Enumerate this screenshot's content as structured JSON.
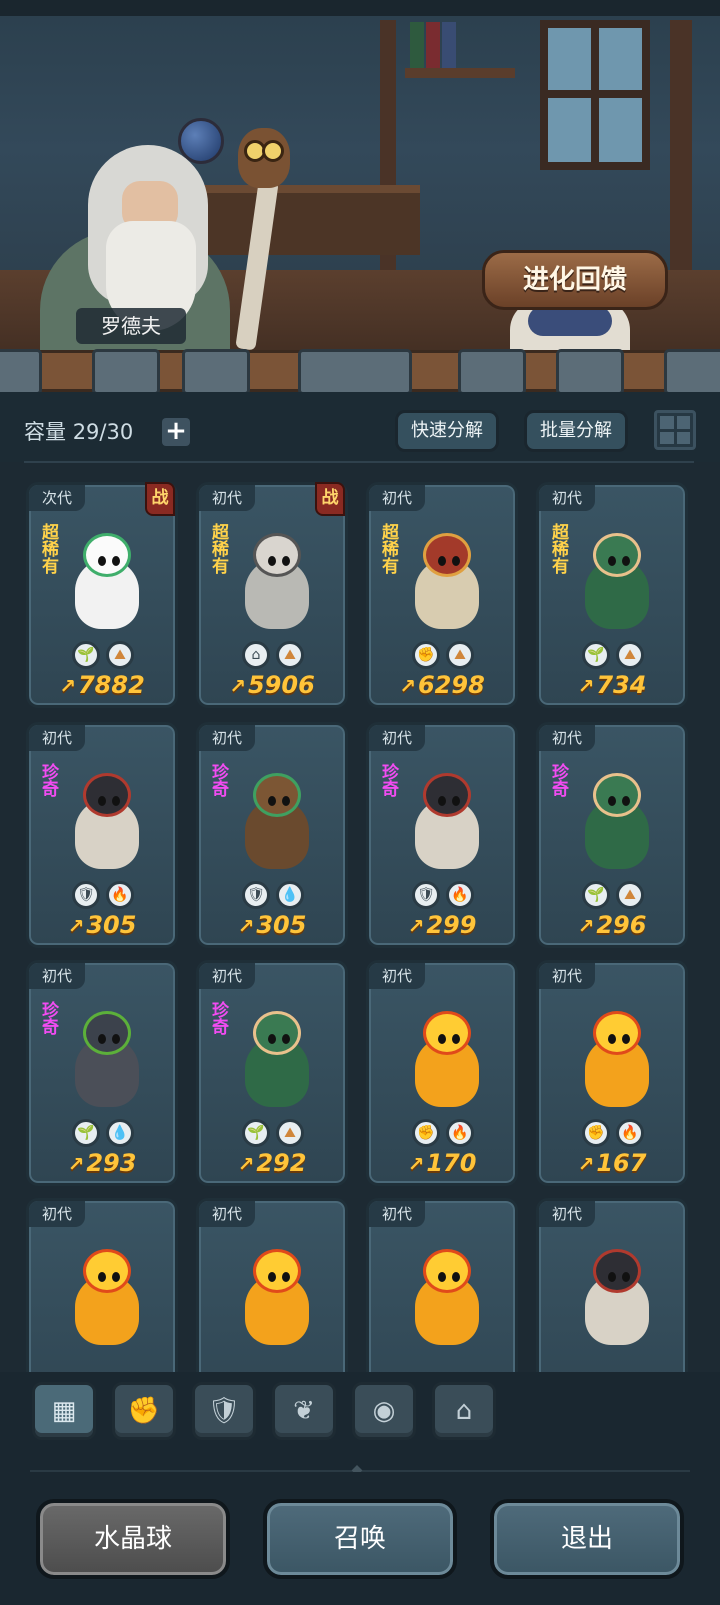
{
  "scene": {
    "npc_name": "罗德夫",
    "evolution_button": "进化回馈"
  },
  "toolbar": {
    "capacity_label": "容量",
    "capacity_value": "29/30",
    "quick_decompose": "快速分解",
    "batch_decompose": "批量分解"
  },
  "cards": [
    {
      "gen": "次代",
      "rarity": "超稀有",
      "rarity_type": "super",
      "battle": "战",
      "icons": [
        "leaf",
        "earth"
      ],
      "power": "7882",
      "creature": "white-dragon"
    },
    {
      "gen": "初代",
      "rarity": "超稀有",
      "rarity_type": "super",
      "battle": "战",
      "icons": [
        "house",
        "earth"
      ],
      "power": "5906",
      "creature": "armored-beast"
    },
    {
      "gen": "初代",
      "rarity": "超稀有",
      "rarity_type": "super",
      "battle": "",
      "icons": [
        "fist",
        "earth"
      ],
      "power": "6298",
      "creature": "mushroom"
    },
    {
      "gen": "初代",
      "rarity": "超稀有",
      "rarity_type": "super",
      "battle": "",
      "icons": [
        "leaf",
        "earth"
      ],
      "power": "734",
      "creature": "moss-golem"
    },
    {
      "gen": "初代",
      "rarity": "珍奇",
      "rarity_type": "rare",
      "battle": "",
      "icons": [
        "shield",
        "fire"
      ],
      "power": "305",
      "creature": "woolly-boar"
    },
    {
      "gen": "初代",
      "rarity": "珍奇",
      "rarity_type": "rare",
      "battle": "",
      "icons": [
        "shield",
        "water"
      ],
      "power": "305",
      "creature": "tree-sprite"
    },
    {
      "gen": "初代",
      "rarity": "珍奇",
      "rarity_type": "rare",
      "battle": "",
      "icons": [
        "shield",
        "fire"
      ],
      "power": "299",
      "creature": "woolly-boar"
    },
    {
      "gen": "初代",
      "rarity": "珍奇",
      "rarity_type": "rare",
      "battle": "",
      "icons": [
        "leaf",
        "earth"
      ],
      "power": "296",
      "creature": "moss-golem"
    },
    {
      "gen": "初代",
      "rarity": "珍奇",
      "rarity_type": "rare",
      "battle": "",
      "icons": [
        "leaf",
        "water"
      ],
      "power": "293",
      "creature": "dark-imp"
    },
    {
      "gen": "初代",
      "rarity": "珍奇",
      "rarity_type": "rare",
      "battle": "",
      "icons": [
        "leaf",
        "earth"
      ],
      "power": "292",
      "creature": "moss-golem"
    },
    {
      "gen": "初代",
      "rarity": "",
      "rarity_type": "",
      "battle": "",
      "icons": [
        "fist",
        "fire"
      ],
      "power": "170",
      "creature": "fire-spirit"
    },
    {
      "gen": "初代",
      "rarity": "",
      "rarity_type": "",
      "battle": "",
      "icons": [
        "fist",
        "fire"
      ],
      "power": "167",
      "creature": "fire-spirit"
    },
    {
      "gen": "初代",
      "rarity": "",
      "rarity_type": "",
      "battle": "",
      "icons": [],
      "power": "",
      "creature": "fire-spirit"
    },
    {
      "gen": "初代",
      "rarity": "",
      "rarity_type": "",
      "battle": "",
      "icons": [],
      "power": "",
      "creature": "fire-spirit"
    },
    {
      "gen": "初代",
      "rarity": "",
      "rarity_type": "",
      "battle": "",
      "icons": [],
      "power": "",
      "creature": "fire-spirit"
    },
    {
      "gen": "初代",
      "rarity": "",
      "rarity_type": "",
      "battle": "",
      "icons": [],
      "power": "",
      "creature": "woolly-boar"
    }
  ],
  "filters": [
    {
      "name": "all",
      "icon": "all-icon"
    },
    {
      "name": "fist",
      "icon": "fist-icon"
    },
    {
      "name": "shield",
      "icon": "shield-icon"
    },
    {
      "name": "leaf",
      "icon": "leaf-icon"
    },
    {
      "name": "alien",
      "icon": "alien-icon"
    },
    {
      "name": "house",
      "icon": "house-icon"
    }
  ],
  "bottom": {
    "crystal_ball": "水晶球",
    "summon": "召唤",
    "exit": "退出"
  },
  "colors": {
    "super_rare": "#ffd24a",
    "rare": "#f24cf2",
    "power": "#ffc43a"
  }
}
